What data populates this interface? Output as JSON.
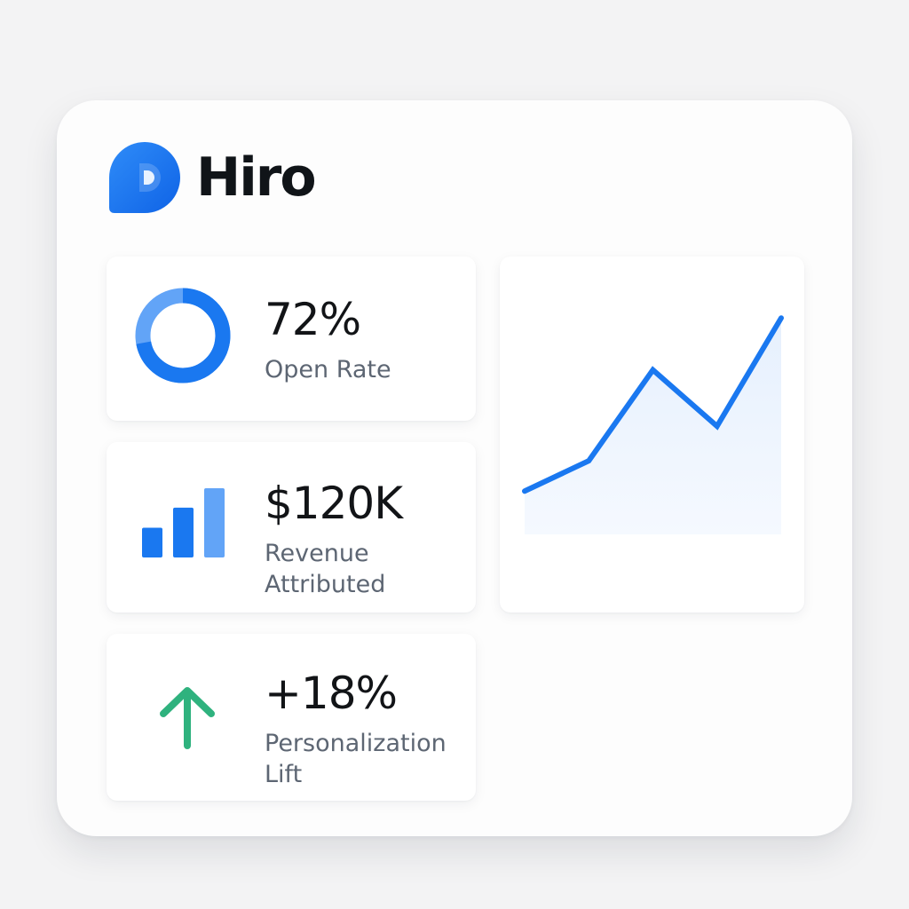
{
  "brand": {
    "name": "Hiro",
    "logo_icon": "chat-bubble-d-logo-icon",
    "color": "#1a78f0"
  },
  "metrics": [
    {
      "value": "72%",
      "label": "Open Rate",
      "icon": "donut-chart-icon",
      "progress_fraction": 0.72
    },
    {
      "value": "$120K",
      "label_line1": "Revenue",
      "label_line2": "Attributed",
      "icon": "bar-chart-icon",
      "bar_levels": [
        0.43,
        0.72,
        1.0
      ]
    },
    {
      "value": "+18%",
      "label_line1": "Personalization",
      "label_line2": "Lift",
      "icon": "arrow-up-icon",
      "icon_color": "#2fb27e"
    }
  ],
  "colors": {
    "accent": "#1a78f0",
    "accent_light": "#62a4f7",
    "positive": "#2fb27e",
    "text_primary": "#121417",
    "text_secondary": "#5d6673"
  },
  "chart_data": {
    "type": "area",
    "title": "",
    "xlabel": "",
    "ylabel": "",
    "x": [
      1,
      2,
      3,
      4,
      5
    ],
    "values": [
      1.0,
      1.7,
      3.8,
      2.5,
      5.0
    ],
    "ylim": [
      0,
      5.6
    ],
    "grid": false,
    "legend": "none",
    "series": [
      {
        "values": [
          1.0,
          1.7,
          3.8,
          2.5,
          5.0
        ]
      }
    ]
  }
}
